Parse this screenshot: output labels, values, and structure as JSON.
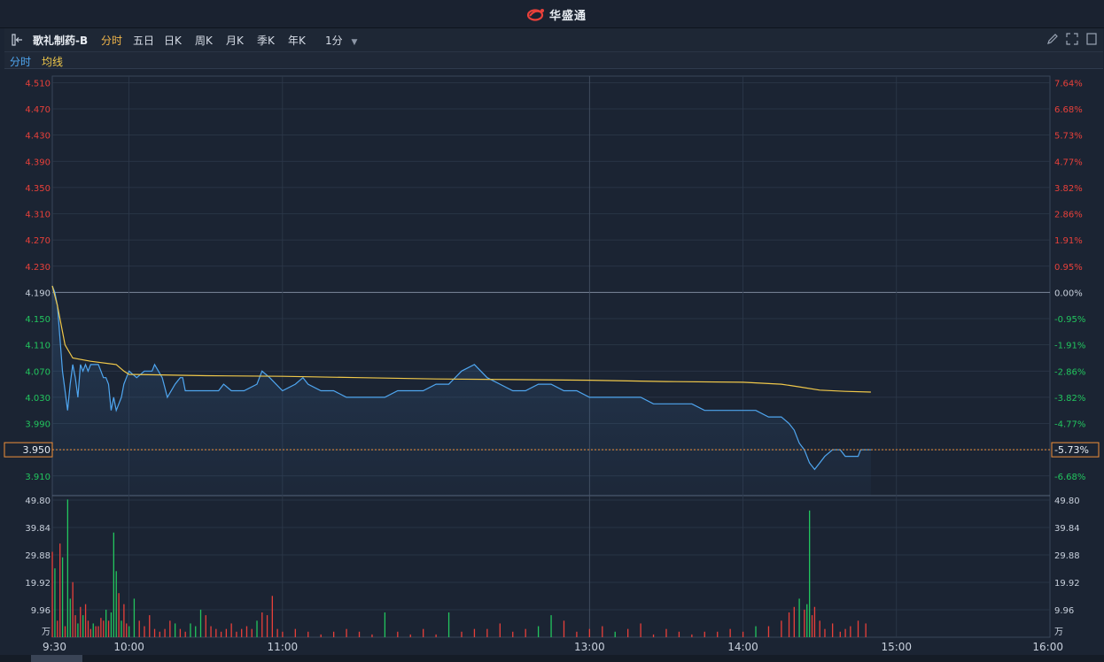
{
  "header": {
    "brand": "华盛通"
  },
  "toolbar": {
    "stock_name": "歌礼制药-B",
    "tabs": [
      "分时",
      "五日",
      "日K",
      "周K",
      "月K",
      "季K",
      "年K"
    ],
    "active_tab": "分时",
    "interval": "1分"
  },
  "legend": {
    "price_label": "分时",
    "avg_label": "均线",
    "price_color": "#4fa6f0",
    "avg_color": "#f0c84a"
  },
  "colors": {
    "up": "#e8403a",
    "down": "#22c55e",
    "grid": "#2d394b",
    "price": "#4fa6f0",
    "avg": "#f0c84a",
    "current": "#f0903a"
  },
  "current": {
    "price_label": "3.950",
    "pct_label": "-5.73%"
  },
  "chart_data": [
    {
      "type": "line",
      "title": "",
      "prev_close": 4.19,
      "ylim": [
        3.88,
        4.52
      ],
      "y_ticks": [
        "4.510",
        "4.470",
        "4.430",
        "4.390",
        "4.350",
        "4.310",
        "4.270",
        "4.230",
        "4.190",
        "4.150",
        "4.110",
        "4.070",
        "4.030",
        "3.990",
        "3.950",
        "3.910"
      ],
      "y_pct_ticks": [
        "7.64%",
        "6.68%",
        "5.73%",
        "4.77%",
        "3.82%",
        "2.86%",
        "1.91%",
        "0.95%",
        "0.00%",
        "-0.95%",
        "-1.91%",
        "-2.86%",
        "-3.82%",
        "-4.77%",
        "-5.73%",
        "-6.68%"
      ],
      "x_ticks": [
        "9:30",
        "10:00",
        "11:00",
        "13:00",
        "14:00",
        "15:00",
        "16:00"
      ],
      "series": [
        {
          "name": "分时",
          "points": [
            [
              "9:30",
              4.2
            ],
            [
              "9:31",
              4.19
            ],
            [
              "9:32",
              4.17
            ],
            [
              "9:33",
              4.12
            ],
            [
              "9:34",
              4.07
            ],
            [
              "9:35",
              4.04
            ],
            [
              "9:36",
              4.01
            ],
            [
              "9:37",
              4.05
            ],
            [
              "9:38",
              4.08
            ],
            [
              "9:39",
              4.06
            ],
            [
              "9:40",
              4.03
            ],
            [
              "9:41",
              4.08
            ],
            [
              "9:42",
              4.07
            ],
            [
              "9:43",
              4.08
            ],
            [
              "9:44",
              4.07
            ],
            [
              "9:45",
              4.08
            ],
            [
              "9:46",
              4.08
            ],
            [
              "9:47",
              4.08
            ],
            [
              "9:48",
              4.08
            ],
            [
              "9:49",
              4.07
            ],
            [
              "9:50",
              4.06
            ],
            [
              "9:51",
              4.06
            ],
            [
              "9:52",
              4.05
            ],
            [
              "9:53",
              4.01
            ],
            [
              "9:54",
              4.03
            ],
            [
              "9:55",
              4.01
            ],
            [
              "9:56",
              4.02
            ],
            [
              "9:57",
              4.03
            ],
            [
              "9:58",
              4.05
            ],
            [
              "9:59",
              4.06
            ],
            [
              "10:00",
              4.07
            ],
            [
              "10:03",
              4.06
            ],
            [
              "10:06",
              4.07
            ],
            [
              "10:09",
              4.07
            ],
            [
              "10:10",
              4.08
            ],
            [
              "10:13",
              4.06
            ],
            [
              "10:15",
              4.03
            ],
            [
              "10:18",
              4.05
            ],
            [
              "10:20",
              4.06
            ],
            [
              "10:21",
              4.06
            ],
            [
              "10:22",
              4.04
            ],
            [
              "10:25",
              4.04
            ],
            [
              "10:30",
              4.04
            ],
            [
              "10:35",
              4.04
            ],
            [
              "10:37",
              4.05
            ],
            [
              "10:40",
              4.04
            ],
            [
              "10:45",
              4.04
            ],
            [
              "10:50",
              4.05
            ],
            [
              "10:52",
              4.07
            ],
            [
              "10:55",
              4.06
            ],
            [
              "11:00",
              4.04
            ],
            [
              "11:05",
              4.05
            ],
            [
              "11:08",
              4.06
            ],
            [
              "11:10",
              4.05
            ],
            [
              "11:15",
              4.04
            ],
            [
              "11:20",
              4.04
            ],
            [
              "11:25",
              4.03
            ],
            [
              "11:30",
              4.03
            ],
            [
              "11:35",
              4.03
            ],
            [
              "11:40",
              4.03
            ],
            [
              "11:45",
              4.04
            ],
            [
              "11:50",
              4.04
            ],
            [
              "11:55",
              4.04
            ],
            [
              "12:00",
              4.05
            ],
            [
              "12:05",
              4.05
            ],
            [
              "12:10",
              4.07
            ],
            [
              "12:15",
              4.08
            ],
            [
              "12:20",
              4.06
            ],
            [
              "12:25",
              4.05
            ],
            [
              "12:30",
              4.04
            ],
            [
              "12:35",
              4.04
            ],
            [
              "12:40",
              4.05
            ],
            [
              "12:45",
              4.05
            ],
            [
              "12:50",
              4.04
            ],
            [
              "12:55",
              4.04
            ],
            [
              "13:00",
              4.03
            ],
            [
              "13:05",
              4.03
            ],
            [
              "13:10",
              4.03
            ],
            [
              "13:15",
              4.03
            ],
            [
              "13:20",
              4.03
            ],
            [
              "13:25",
              4.02
            ],
            [
              "13:30",
              4.02
            ],
            [
              "13:35",
              4.02
            ],
            [
              "13:40",
              4.02
            ],
            [
              "13:45",
              4.01
            ],
            [
              "13:50",
              4.01
            ],
            [
              "13:55",
              4.01
            ],
            [
              "14:00",
              4.01
            ],
            [
              "14:05",
              4.01
            ],
            [
              "14:10",
              4.0
            ],
            [
              "14:15",
              4.0
            ],
            [
              "14:18",
              3.99
            ],
            [
              "14:20",
              3.98
            ],
            [
              "14:22",
              3.96
            ],
            [
              "14:24",
              3.95
            ],
            [
              "14:26",
              3.93
            ],
            [
              "14:28",
              3.92
            ],
            [
              "14:30",
              3.93
            ],
            [
              "14:32",
              3.94
            ],
            [
              "14:35",
              3.95
            ],
            [
              "14:38",
              3.95
            ],
            [
              "14:40",
              3.94
            ],
            [
              "14:43",
              3.94
            ],
            [
              "14:45",
              3.94
            ],
            [
              "14:46",
              3.95
            ],
            [
              "14:48",
              3.95
            ],
            [
              "14:50",
              3.95
            ]
          ]
        },
        {
          "name": "均线",
          "points": [
            [
              "9:30",
              4.2
            ],
            [
              "9:32",
              4.17
            ],
            [
              "9:35",
              4.11
            ],
            [
              "9:38",
              4.09
            ],
            [
              "9:45",
              4.085
            ],
            [
              "9:55",
              4.08
            ],
            [
              "9:58",
              4.07
            ],
            [
              "10:00",
              4.065
            ],
            [
              "10:30",
              4.063
            ],
            [
              "11:00",
              4.062
            ],
            [
              "11:30",
              4.06
            ],
            [
              "12:00",
              4.058
            ],
            [
              "12:30",
              4.057
            ],
            [
              "13:00",
              4.056
            ],
            [
              "13:30",
              4.054
            ],
            [
              "14:00",
              4.053
            ],
            [
              "14:15",
              4.05
            ],
            [
              "14:22",
              4.046
            ],
            [
              "14:30",
              4.041
            ],
            [
              "14:40",
              4.039
            ],
            [
              "14:50",
              4.038
            ]
          ]
        }
      ]
    },
    {
      "type": "bar",
      "title": "",
      "unit": "万",
      "ylim": [
        0,
        49.8
      ],
      "y_ticks": [
        "49.80",
        "39.84",
        "29.88",
        "19.92",
        "9.96"
      ],
      "bars": [
        [
          "9:30",
          31,
          "up"
        ],
        [
          "9:31",
          25,
          "down"
        ],
        [
          "9:32",
          6,
          "up"
        ],
        [
          "9:33",
          34,
          "up"
        ],
        [
          "9:34",
          29,
          "down"
        ],
        [
          "9:35",
          4,
          "up"
        ],
        [
          "9:36",
          50,
          "down"
        ],
        [
          "9:37",
          14,
          "down"
        ],
        [
          "9:38",
          20,
          "up"
        ],
        [
          "9:39",
          8,
          "up"
        ],
        [
          "9:40",
          5,
          "down"
        ],
        [
          "9:41",
          11,
          "up"
        ],
        [
          "9:42",
          8,
          "down"
        ],
        [
          "9:43",
          12,
          "up"
        ],
        [
          "9:44",
          6,
          "up"
        ],
        [
          "9:45",
          3,
          "up"
        ],
        [
          "9:46",
          5,
          "down"
        ],
        [
          "9:47",
          4,
          "up"
        ],
        [
          "9:48",
          4,
          "up"
        ],
        [
          "9:49",
          7,
          "up"
        ],
        [
          "9:50",
          6,
          "up"
        ],
        [
          "9:51",
          10,
          "down"
        ],
        [
          "9:52",
          6,
          "up"
        ],
        [
          "9:53",
          9,
          "down"
        ],
        [
          "9:54",
          38,
          "down"
        ],
        [
          "9:55",
          24,
          "down"
        ],
        [
          "9:56",
          16,
          "up"
        ],
        [
          "9:57",
          6,
          "down"
        ],
        [
          "9:58",
          12,
          "up"
        ],
        [
          "9:59",
          5,
          "up"
        ],
        [
          "10:00",
          4,
          "down"
        ],
        [
          "10:02",
          14,
          "down"
        ],
        [
          "10:04",
          6,
          "up"
        ],
        [
          "10:06",
          4,
          "up"
        ],
        [
          "10:08",
          8,
          "up"
        ],
        [
          "10:10",
          3,
          "up"
        ],
        [
          "10:12",
          2,
          "up"
        ],
        [
          "10:14",
          3,
          "up"
        ],
        [
          "10:16",
          6,
          "up"
        ],
        [
          "10:18",
          5,
          "down"
        ],
        [
          "10:20",
          3,
          "up"
        ],
        [
          "10:22",
          2,
          "up"
        ],
        [
          "10:24",
          5,
          "down"
        ],
        [
          "10:26",
          4,
          "down"
        ],
        [
          "10:28",
          10,
          "down"
        ],
        [
          "10:30",
          8,
          "up"
        ],
        [
          "10:32",
          4,
          "up"
        ],
        [
          "10:34",
          3,
          "up"
        ],
        [
          "10:36",
          2,
          "up"
        ],
        [
          "10:38",
          3,
          "up"
        ],
        [
          "10:40",
          5,
          "up"
        ],
        [
          "10:42",
          2,
          "up"
        ],
        [
          "10:44",
          3,
          "up"
        ],
        [
          "10:46",
          4,
          "up"
        ],
        [
          "10:48",
          3,
          "up"
        ],
        [
          "10:50",
          6,
          "down"
        ],
        [
          "10:52",
          9,
          "up"
        ],
        [
          "10:54",
          8,
          "up"
        ],
        [
          "10:56",
          15,
          "up"
        ],
        [
          "10:58",
          3,
          "up"
        ],
        [
          "11:00",
          2,
          "up"
        ],
        [
          "11:05",
          3,
          "up"
        ],
        [
          "11:10",
          2,
          "up"
        ],
        [
          "11:15",
          1,
          "up"
        ],
        [
          "11:20",
          2,
          "up"
        ],
        [
          "11:25",
          3,
          "up"
        ],
        [
          "11:30",
          2,
          "up"
        ],
        [
          "11:35",
          1,
          "up"
        ],
        [
          "11:40",
          9,
          "down"
        ],
        [
          "11:45",
          2,
          "up"
        ],
        [
          "11:50",
          1,
          "up"
        ],
        [
          "11:55",
          3,
          "up"
        ],
        [
          "12:00",
          1,
          "up"
        ],
        [
          "12:05",
          9,
          "down"
        ],
        [
          "12:10",
          2,
          "up"
        ],
        [
          "12:15",
          3,
          "up"
        ],
        [
          "12:20",
          3,
          "up"
        ],
        [
          "12:25",
          5,
          "up"
        ],
        [
          "12:30",
          2,
          "up"
        ],
        [
          "12:35",
          3,
          "up"
        ],
        [
          "12:40",
          4,
          "down"
        ],
        [
          "12:45",
          8,
          "down"
        ],
        [
          "12:50",
          6,
          "up"
        ],
        [
          "12:55",
          2,
          "up"
        ],
        [
          "13:00",
          3,
          "up"
        ],
        [
          "13:05",
          4,
          "up"
        ],
        [
          "13:10",
          2,
          "down"
        ],
        [
          "13:15",
          3,
          "up"
        ],
        [
          "13:20",
          5,
          "up"
        ],
        [
          "13:25",
          1,
          "up"
        ],
        [
          "13:30",
          3,
          "up"
        ],
        [
          "13:35",
          2,
          "up"
        ],
        [
          "13:40",
          1,
          "up"
        ],
        [
          "13:45",
          2,
          "up"
        ],
        [
          "13:50",
          2,
          "up"
        ],
        [
          "13:55",
          3,
          "up"
        ],
        [
          "14:00",
          2,
          "up"
        ],
        [
          "14:05",
          4,
          "down"
        ],
        [
          "14:10",
          4,
          "up"
        ],
        [
          "14:15",
          6,
          "up"
        ],
        [
          "14:18",
          9,
          "up"
        ],
        [
          "14:20",
          11,
          "up"
        ],
        [
          "14:22",
          14,
          "down"
        ],
        [
          "14:24",
          10,
          "up"
        ],
        [
          "14:25",
          12,
          "down"
        ],
        [
          "14:26",
          46,
          "down"
        ],
        [
          "14:27",
          8,
          "up"
        ],
        [
          "14:28",
          11,
          "up"
        ],
        [
          "14:30",
          6,
          "up"
        ],
        [
          "14:32",
          3,
          "up"
        ],
        [
          "14:35",
          5,
          "up"
        ],
        [
          "14:38",
          2,
          "up"
        ],
        [
          "14:40",
          3,
          "up"
        ],
        [
          "14:42",
          4,
          "up"
        ],
        [
          "14:45",
          6,
          "up"
        ],
        [
          "14:48",
          5,
          "up"
        ]
      ]
    }
  ]
}
